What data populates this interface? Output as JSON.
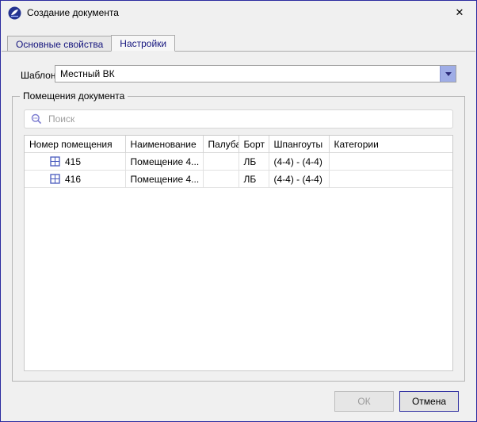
{
  "window": {
    "title": "Создание документа"
  },
  "icons": {
    "close": "✕"
  },
  "tabs": {
    "basic": "Основные свойства",
    "settings": "Настройки"
  },
  "template": {
    "label": "Шаблон:",
    "value": "Местный ВК"
  },
  "rooms_group": {
    "title": "Помещения документа"
  },
  "search": {
    "placeholder": "Поиск"
  },
  "table": {
    "columns": [
      "Номер помещения",
      "Наименование",
      "Палуба",
      "Борт",
      "Шпангоуты",
      "Категории"
    ],
    "rows": [
      [
        "415",
        "Помещение 4...",
        "",
        "ЛБ",
        "(4-4) - (4-4)",
        ""
      ],
      [
        "416",
        "Помещение 4...",
        "",
        "ЛБ",
        "(4-4) - (4-4)",
        ""
      ]
    ]
  },
  "buttons": {
    "ok": "ОК",
    "cancel": "Отмена"
  },
  "colors": {
    "accent_border": "#2b2ba0",
    "tab_text": "#15157e",
    "combo_arrow_bg": "#9fade6",
    "row_icon": "#4759bd",
    "search_icon": "#7b7bd0"
  }
}
